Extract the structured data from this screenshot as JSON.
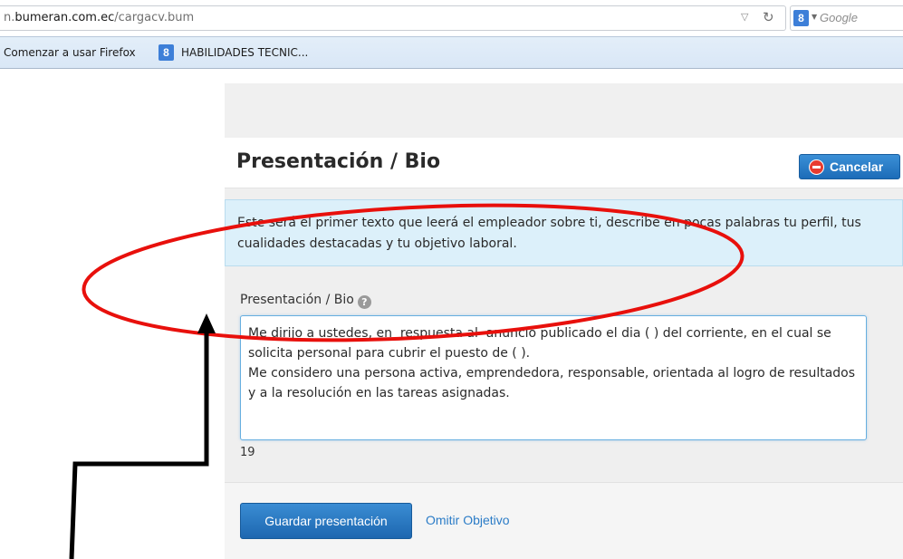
{
  "browser": {
    "url_prefix": "n.",
    "url_host": "bumeran.com.ec",
    "url_path": "/cargacv.bum",
    "search_engine_letter": "8",
    "search_placeholder": "Google",
    "bookmarks": [
      {
        "label": "Comenzar a usar Firefox"
      },
      {
        "label": "HABILIDADES TECNIC..."
      }
    ]
  },
  "page": {
    "title": "Presentación / Bio",
    "cancel_label": "Cancelar",
    "info_text": "Este será el primer texto que leerá el empleador sobre ti, describe en pocas palabras tu perfil, tus cualidades destacadas y tu objetivo laboral.",
    "field_label": "Presentación / Bio",
    "help_glyph": "?",
    "bio_value": "Me dirijo a ustedes, en  respuesta al  anuncio publicado el dia ( ) del corriente, en el cual se solicita personal para cubrir el puesto de ( ).\nMe considero una persona activa, emprendedora, responsable, orientada al logro de resultados y a la resolución en las tareas asignadas.",
    "char_count": "19",
    "save_label": "Guardar presentación",
    "skip_label": "Omitir Objetivo"
  },
  "colors": {
    "accent_blue": "#1c6cb8",
    "info_bg": "#dcf0fa",
    "annotation_red": "#e8100c",
    "annotation_black": "#000000"
  },
  "icons": {
    "reload": "reload-icon",
    "dropdown": "dropdown-arrow-icon",
    "search_engine": "google-icon",
    "cancel": "cancel-circle-icon",
    "help": "help-question-icon"
  }
}
